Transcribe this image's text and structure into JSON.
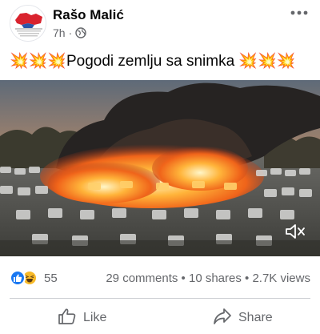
{
  "post": {
    "author": "Rašo Malić",
    "time": "7h",
    "visibility_icon": "globe-icon",
    "more_icon": "more-options-icon",
    "caption_prefix": "💥💥💥",
    "caption_text": "Pogodi zemlju sa snimka ",
    "caption_suffix": "💥💥💥"
  },
  "media": {
    "type": "video",
    "mute_icon": "volume-muted-icon"
  },
  "stats": {
    "reaction_icons": [
      "like-reaction-icon",
      "haha-reaction-icon"
    ],
    "reaction_count": "55",
    "comments": "29 comments",
    "separator": " • ",
    "shares": "10 shares",
    "views": "2.7K views"
  },
  "actions": {
    "like_label": "Like",
    "share_label": "Share"
  },
  "colors": {
    "secondary_text": "#65676b",
    "primary_text": "#050505",
    "like_blue": "#1877f2",
    "haha_yellow": "#f7b928",
    "divider": "#ced0d4"
  }
}
